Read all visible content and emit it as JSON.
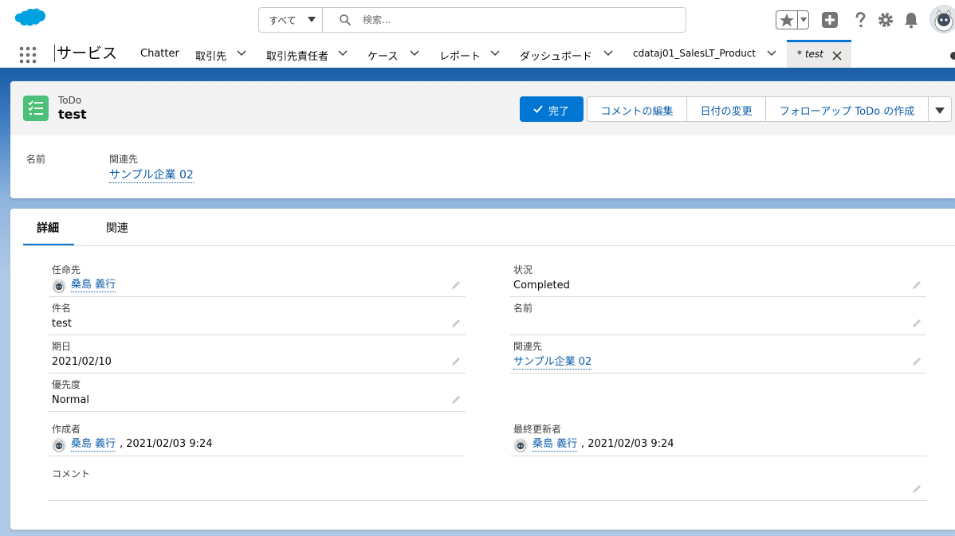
{
  "header": {
    "search_scope": "すべて",
    "search_placeholder": "検索..."
  },
  "nav": {
    "app_name": "サービス",
    "items": [
      {
        "label": "Chatter"
      },
      {
        "label": "取引先"
      },
      {
        "label": "取引先責任者"
      },
      {
        "label": "ケース"
      },
      {
        "label": "レポート"
      },
      {
        "label": "ダッシュボード"
      },
      {
        "label": "cdataj01_SalesLT_Product"
      }
    ],
    "active_tab": "* test"
  },
  "record": {
    "type": "ToDo",
    "name": "test",
    "actions": {
      "complete": "完了",
      "edit_comment": "コメントの編集",
      "change_date": "日付の変更",
      "create_followup": "フォローアップ ToDo の作成"
    },
    "highlights": [
      {
        "label": "名前",
        "value": ""
      },
      {
        "label": "関連先",
        "value": "サンプル企業 02"
      }
    ]
  },
  "tabs": [
    {
      "label": "詳細",
      "active": true
    },
    {
      "label": "関連",
      "active": false
    }
  ],
  "fields": {
    "assignee": {
      "label": "任命先",
      "value": "桑島 義行"
    },
    "status": {
      "label": "状況",
      "value": "Completed"
    },
    "subject": {
      "label": "件名",
      "value": "test"
    },
    "name": {
      "label": "名前",
      "value": ""
    },
    "due_date": {
      "label": "期日",
      "value": "2021/02/10"
    },
    "related_to": {
      "label": "関連先",
      "value": "サンプル企業 02"
    },
    "priority": {
      "label": "優先度",
      "value": "Normal"
    },
    "created_by": {
      "label": "作成者",
      "user": "桑島 義行",
      "date": ", 2021/02/03 9:24"
    },
    "last_modified_by": {
      "label": "最終更新者",
      "user": "桑島 義行",
      "date": ", 2021/02/03 9:24"
    },
    "comment": {
      "label": "コメント",
      "value": ""
    }
  },
  "colors": {
    "brand": "#0176d3",
    "link": "#0b5cab",
    "task_icon": "#4bc076",
    "cloud_logo": "#00a1e0"
  }
}
